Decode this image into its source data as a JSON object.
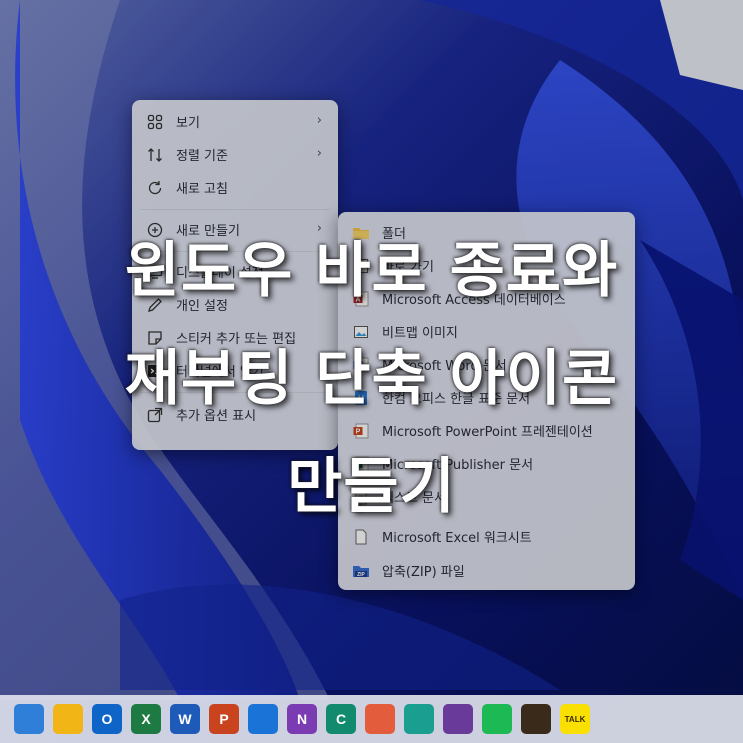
{
  "context_menu": {
    "items": [
      {
        "label": "보기",
        "icon": "grid-view-icon",
        "has_submenu": true
      },
      {
        "label": "정렬 기준",
        "icon": "sort-icon",
        "has_submenu": true
      },
      {
        "label": "새로 고침",
        "icon": "refresh-icon",
        "has_submenu": false
      },
      {
        "label": "새로 만들기",
        "icon": "new-plus-icon",
        "has_submenu": true
      },
      {
        "label": "디스플레이 설정",
        "icon": "display-icon",
        "has_submenu": false
      },
      {
        "label": "개인 설정",
        "icon": "pen-icon",
        "has_submenu": false
      },
      {
        "label": "스티커 추가 또는 편집",
        "icon": "sticker-icon",
        "has_submenu": false
      },
      {
        "label": "터미널에서 열기",
        "icon": "terminal-icon",
        "has_submenu": false
      },
      {
        "label": "추가 옵션 표시",
        "icon": "more-options-icon",
        "has_submenu": false
      }
    ]
  },
  "new_submenu": {
    "items": [
      {
        "label": "폴더",
        "icon": "folder-icon"
      },
      {
        "label": "바로 가기",
        "icon": "shortcut-icon"
      },
      {
        "label": "Microsoft Access 데이터베이스",
        "icon": "access-icon"
      },
      {
        "label": "비트맵 이미지",
        "icon": "bitmap-icon"
      },
      {
        "label": "Microsoft Word 문서",
        "icon": "word-doc-icon"
      },
      {
        "label": "한컴 오피스 한글 표준 문서",
        "icon": "hwp-doc-icon"
      },
      {
        "label": "Microsoft PowerPoint 프레젠테이션",
        "icon": "powerpoint-icon"
      },
      {
        "label": "Microsoft Publisher 문서",
        "icon": "publisher-icon"
      },
      {
        "label": "텍스트 문서",
        "icon": "text-doc-icon"
      },
      {
        "label": "Microsoft Excel 워크시트",
        "icon": "excel-sheet-icon"
      },
      {
        "label": "압축(ZIP) 파일",
        "icon": "zip-icon"
      }
    ]
  },
  "overlay_title": {
    "line1": "윈도우 바로 종료와",
    "line2": "재부팅 단축 아이콘",
    "line3": "만들기"
  },
  "taskbar": {
    "apps": [
      {
        "name": "notepad-icon",
        "label": "",
        "color": "#2f7fd8"
      },
      {
        "name": "app-yellow-icon",
        "label": "",
        "color": "#f2b516"
      },
      {
        "name": "outlook-icon",
        "label": "O",
        "color": "#0f64c8"
      },
      {
        "name": "excel-icon",
        "label": "X",
        "color": "#1d7a43"
      },
      {
        "name": "word-icon",
        "label": "W",
        "color": "#1e5ab8"
      },
      {
        "name": "powerpoint-icon",
        "label": "P",
        "color": "#c9431f"
      },
      {
        "name": "outlook-new-icon",
        "label": "",
        "color": "#1a73d6"
      },
      {
        "name": "onenote-icon",
        "label": "N",
        "color": "#7a3bb3"
      },
      {
        "name": "copilot-app-icon",
        "label": "C",
        "color": "#128a6e"
      },
      {
        "name": "paint-icon",
        "label": "",
        "color": "#e35d3c"
      },
      {
        "name": "edge-icon",
        "label": "",
        "color": "#1a9e8f"
      },
      {
        "name": "image-app-icon",
        "label": "",
        "color": "#6a3a9a"
      },
      {
        "name": "spotify-icon",
        "label": "",
        "color": "#1db954"
      },
      {
        "name": "game-app-icon",
        "label": "",
        "color": "#3a2a1a"
      },
      {
        "name": "kakaotalk-icon",
        "label": "TALK",
        "color": "#f9e000"
      }
    ]
  }
}
